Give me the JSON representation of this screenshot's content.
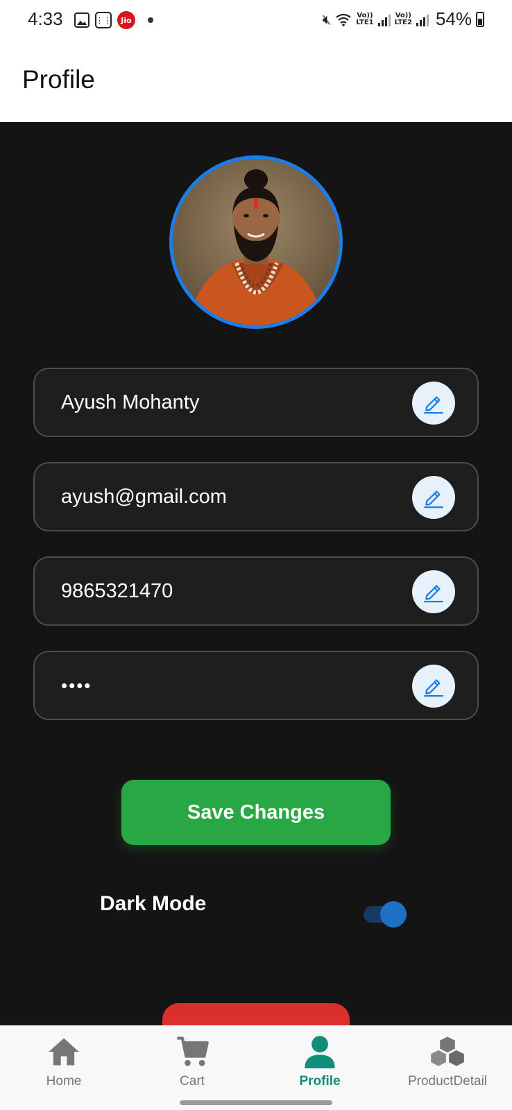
{
  "status_bar": {
    "time": "4:33",
    "battery": "54%",
    "jio_label": "Jio",
    "lte1": "Vo)) LTE1",
    "lte2": "Vo)) LTE2"
  },
  "header": {
    "title": "Profile"
  },
  "profile": {
    "avatar_alt": "profile-photo",
    "fields": [
      {
        "name": "name-field",
        "value": "Ayush Mohanty",
        "type": "text"
      },
      {
        "name": "email-field",
        "value": "ayush@gmail.com",
        "type": "text"
      },
      {
        "name": "phone-field",
        "value": "9865321470",
        "type": "text"
      },
      {
        "name": "password-field",
        "value": "••••",
        "type": "password"
      }
    ],
    "save_label": "Save Changes",
    "dark_mode_label": "Dark Mode",
    "dark_mode_enabled": true
  },
  "bottom_nav": {
    "items": [
      {
        "label": "Home",
        "icon": "home-icon",
        "active": false
      },
      {
        "label": "Cart",
        "icon": "cart-icon",
        "active": false
      },
      {
        "label": "Profile",
        "icon": "person-icon",
        "active": true
      },
      {
        "label": "ProductDetail",
        "icon": "cubes-icon",
        "active": false
      }
    ]
  },
  "colors": {
    "accent_blue": "#1a7de8",
    "save_green": "#2aa745",
    "logout_red": "#d9302d",
    "active_nav": "#0f8f7a",
    "background": "#141414"
  }
}
